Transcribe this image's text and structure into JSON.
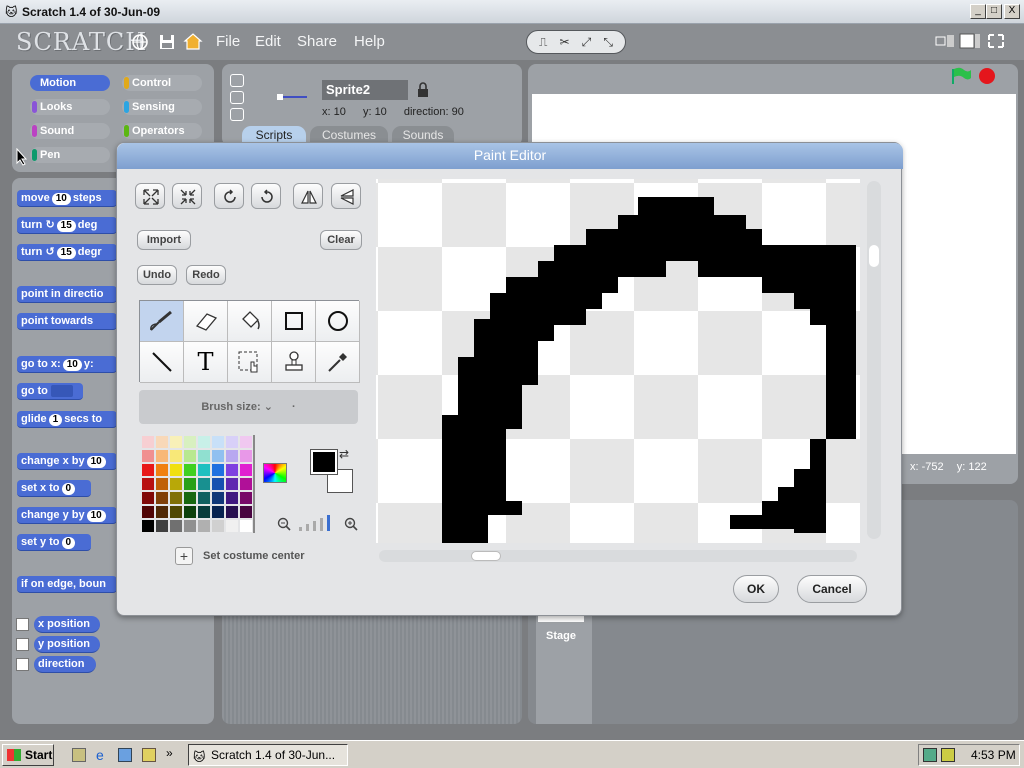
{
  "window": {
    "title": "Scratch 1.4 of 30-Jun-09",
    "min": "_",
    "max": "□",
    "close": "X"
  },
  "app": {
    "logo": "SCRATCH",
    "menus": [
      "File",
      "Edit",
      "Share",
      "Help"
    ]
  },
  "categories": [
    {
      "label": "Motion",
      "color": "#4a6cd4"
    },
    {
      "label": "Control",
      "color": "#e1a91a"
    },
    {
      "label": "Looks",
      "color": "#8a55d7"
    },
    {
      "label": "Sensing",
      "color": "#2ca5e2"
    },
    {
      "label": "Sound",
      "color": "#bb42c3"
    },
    {
      "label": "Operators",
      "color": "#5cb712"
    },
    {
      "label": "Pen",
      "color": "#0e9a6c"
    }
  ],
  "blocks": {
    "move": {
      "pre": "move",
      "num": "10",
      "post": "steps"
    },
    "turn_cw": {
      "pre": "turn ↻",
      "num": "15",
      "post": "deg"
    },
    "turn_ccw": {
      "pre": "turn ↺",
      "num": "15",
      "post": "degr"
    },
    "point_dir": "point in directio",
    "point_towards": "point towards",
    "goto_xy": {
      "pre": "go to x:",
      "num": "10",
      "post": "y:"
    },
    "goto": "go to",
    "glide": {
      "pre": "glide",
      "num": "1",
      "post": "secs to"
    },
    "change_x": {
      "pre": "change x by",
      "num": "10"
    },
    "set_x": {
      "pre": "set x to",
      "num": "0"
    },
    "change_y": {
      "pre": "change y by",
      "num": "10"
    },
    "set_y": {
      "pre": "set y to",
      "num": "0"
    },
    "bounce": "if on edge, boun",
    "x_position": "x position",
    "y_position": "y position",
    "direction": "direction"
  },
  "sprite": {
    "name": "Sprite2",
    "x_label": "x:",
    "x": "10",
    "y_label": "y:",
    "y": "10",
    "dir_label": "direction:",
    "dir": "90"
  },
  "tabs": [
    "Scripts",
    "Costumes",
    "Sounds"
  ],
  "stage": {
    "mouse_x_label": "x:",
    "mouse_x": "-752",
    "mouse_y_label": "y:",
    "mouse_y": "122",
    "stage_label": "Stage"
  },
  "paint_editor": {
    "title": "Paint Editor",
    "import": "Import",
    "clear": "Clear",
    "undo": "Undo",
    "redo": "Redo",
    "brush_size": "Brush size:",
    "set_center": "Set costume center",
    "ok": "OK",
    "cancel": "Cancel",
    "fg_color": "#000000",
    "bg_color": "#ffffff"
  },
  "taskbar": {
    "start": "Start",
    "task": "Scratch 1.4 of 30-Jun...",
    "time": "4:53 PM"
  }
}
